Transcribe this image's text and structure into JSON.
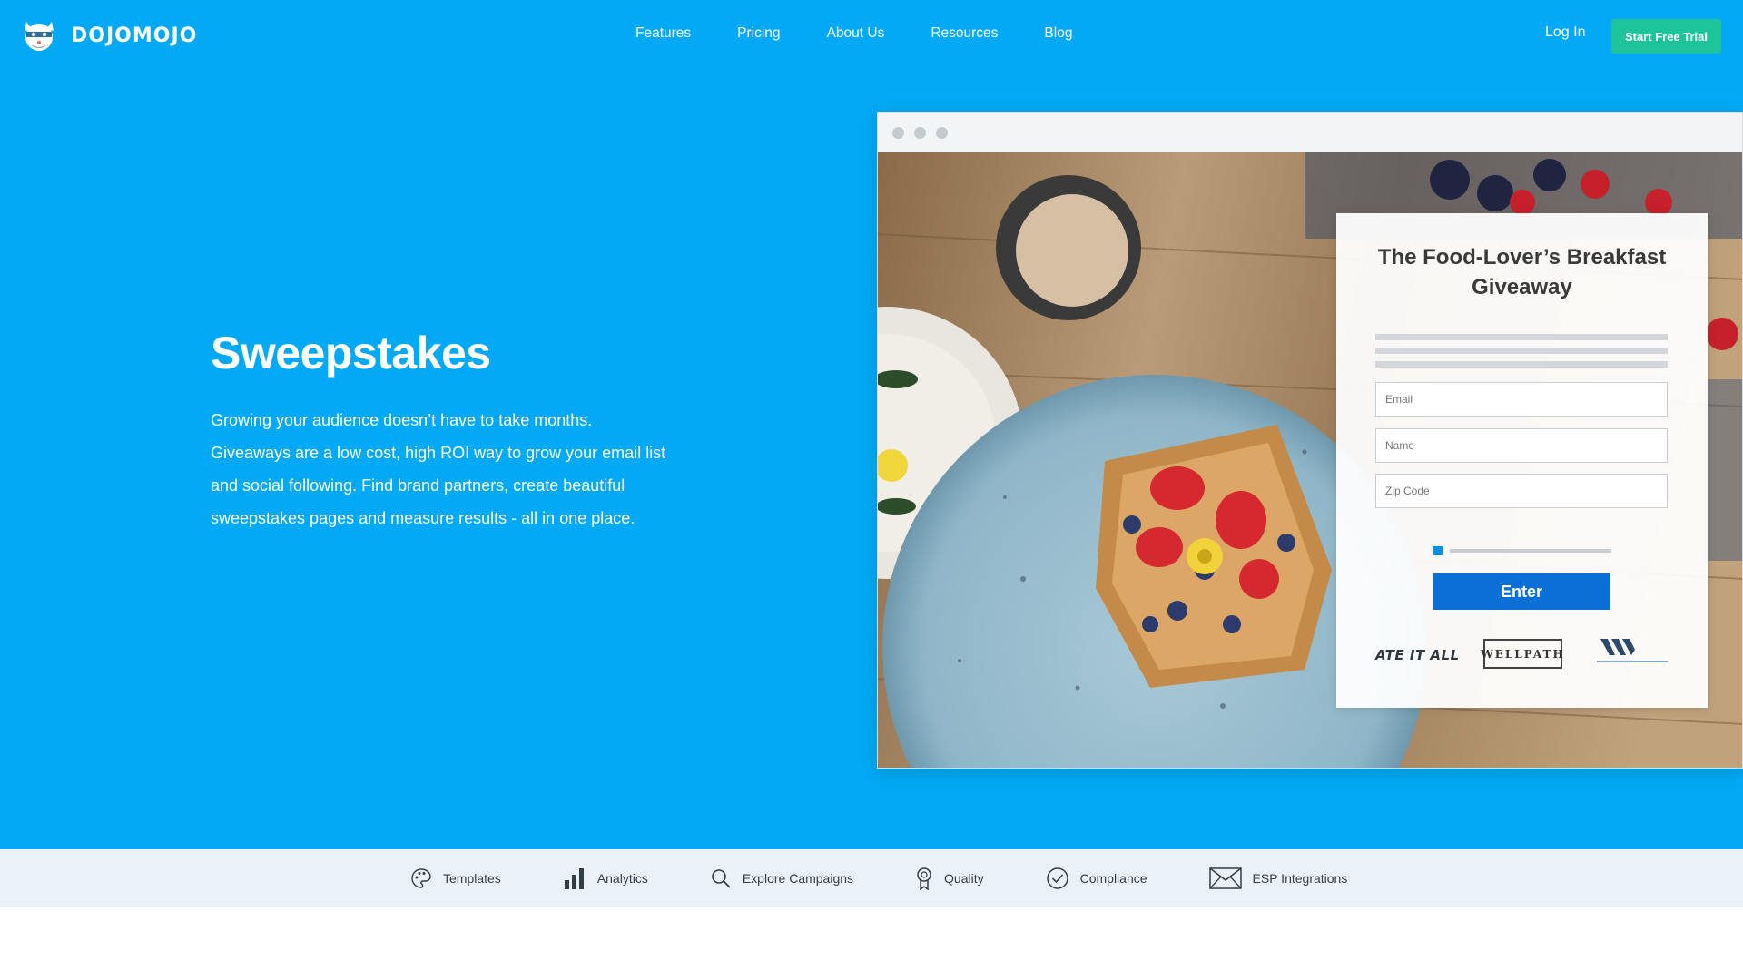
{
  "brand": {
    "name": "DOJOMOJO",
    "logo_icon": "ninja-cat-logo-icon"
  },
  "nav": {
    "items": [
      {
        "label": "Features"
      },
      {
        "label": "Pricing"
      },
      {
        "label": "About Us"
      },
      {
        "label": "Resources"
      },
      {
        "label": "Blog"
      }
    ],
    "login_label": "Log In",
    "cta_label": "Start Free Trial"
  },
  "hero": {
    "title": "Sweepstakes",
    "description": "Growing your audience doesn’t have to take months. Giveaways are a low cost, high ROI way to grow your email list and social following. Find brand partners, create beautiful sweepstakes pages and measure results - all in one place."
  },
  "preview": {
    "card_title": "The Food-Lover’s Breakfast Giveaway",
    "fields": [
      {
        "placeholder": "Email"
      },
      {
        "placeholder": "Name"
      },
      {
        "placeholder": "Zip Code"
      }
    ],
    "enter_label": "Enter",
    "partner_brands": [
      {
        "name": "ATE IT ALL"
      },
      {
        "name": "WELLPATH"
      }
    ],
    "photo_description_icon": "breakfast-food-photo"
  },
  "feature_bar": {
    "items": [
      {
        "label": "Templates",
        "icon": "palette-icon"
      },
      {
        "label": "Analytics",
        "icon": "bar-chart-icon"
      },
      {
        "label": "Explore Campaigns",
        "icon": "search-icon"
      },
      {
        "label": "Quality",
        "icon": "award-ribbon-icon"
      },
      {
        "label": "Compliance",
        "icon": "check-circle-icon"
      },
      {
        "label": "ESP Integrations",
        "icon": "envelope-icon"
      }
    ]
  },
  "colors": {
    "hero_bg": "#03a9f4",
    "cta_bg": "#1dc49a",
    "enter_bg": "#0a6fd6",
    "feature_bar_bg": "#eaf2f8"
  }
}
